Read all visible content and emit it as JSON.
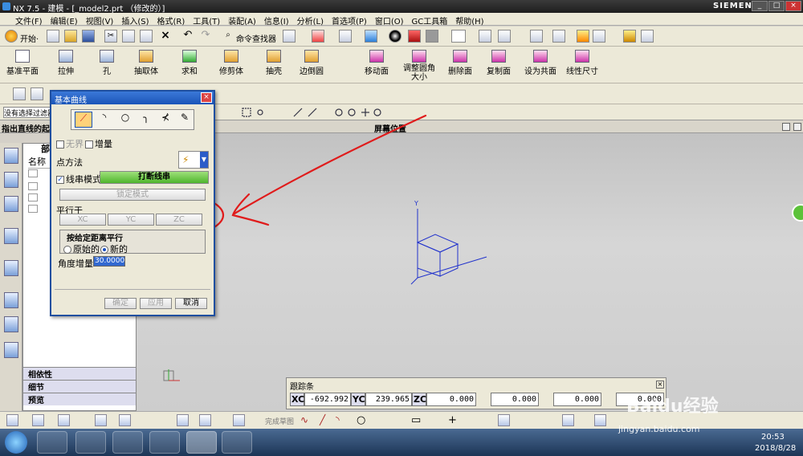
{
  "window": {
    "title": "NX 7.5 - 建模 - [_model2.prt （修改的）]",
    "brand": "SIEMENS",
    "controls": [
      "_",
      "□",
      "×"
    ]
  },
  "menu": [
    "文件(F)",
    "编辑(E)",
    "视图(V)",
    "插入(S)",
    "格式(R)",
    "工具(T)",
    "装配(A)",
    "信息(I)",
    "分析(L)",
    "首选项(P)",
    "窗口(O)",
    "GC工具箱",
    "帮助(H)"
  ],
  "standard_toolbar": {
    "start": "开始·",
    "command_finder": "命令查找器"
  },
  "feature_toolbar": {
    "items": [
      "基准平面",
      "拉伸",
      "孔",
      "抽取体",
      "求和",
      "修剪体",
      "抽壳",
      "边倒圆"
    ],
    "sync_items": [
      "移动面",
      "调整圆角大小",
      "删除面",
      "复制面",
      "设为共面",
      "线性尺寸"
    ]
  },
  "selection_bar": {
    "filter": "没有选择过滤器",
    "prompt": "指出直线的起点",
    "status": "屏幕位置"
  },
  "nav_panel": {
    "header": "部",
    "column": "名称",
    "sections": [
      "相依性",
      "细节",
      "预览"
    ]
  },
  "dialog": {
    "title": "基本曲线",
    "unbounded": "无界",
    "incremental": "增量",
    "point_method": "点方法",
    "string_mode": "线串模式",
    "break_string": "打断线串",
    "lock_mode": "锁定模式",
    "parallel_to": "平行于",
    "xc": "XC",
    "yc": "YC",
    "zc": "ZC",
    "offset_parallel": "按给定距离平行",
    "original": "原始的",
    "new": "新的",
    "angle_increment_label": "角度增量",
    "angle_increment_value": "30.0000",
    "ok": "确定",
    "apply": "应用",
    "cancel": "取消"
  },
  "tracker": {
    "title": "跟踪条",
    "xc_label": "XC",
    "xc_value": "-692.992",
    "yc_label": "YC",
    "yc_value": "239.965",
    "zc_label": "ZC",
    "zc_value": "0.000",
    "length_value": "0.000",
    "angle_value": "0.000",
    "offset_value": "0.000"
  },
  "bottom_toolbar": {
    "finish_sketch": "完成草图"
  },
  "taskbar": {
    "time": "20:53",
    "date": "2018/8/28",
    "watermark": "Baidu经验",
    "watermark_url": "jingyan.baidu.com"
  },
  "colors": {
    "accent": "#1a55b8",
    "annotation": "#e01b1b",
    "green_button": "#5cc23a"
  },
  "icons": [
    "app-logo-icon",
    "new-icon",
    "open-icon",
    "save-icon",
    "cut-icon",
    "copy-icon",
    "paste-icon",
    "delete-icon",
    "undo-icon",
    "redo-icon",
    "line-icon",
    "arc-icon",
    "circle-icon",
    "fillet-icon",
    "trim-icon",
    "edit-curve-icon"
  ]
}
